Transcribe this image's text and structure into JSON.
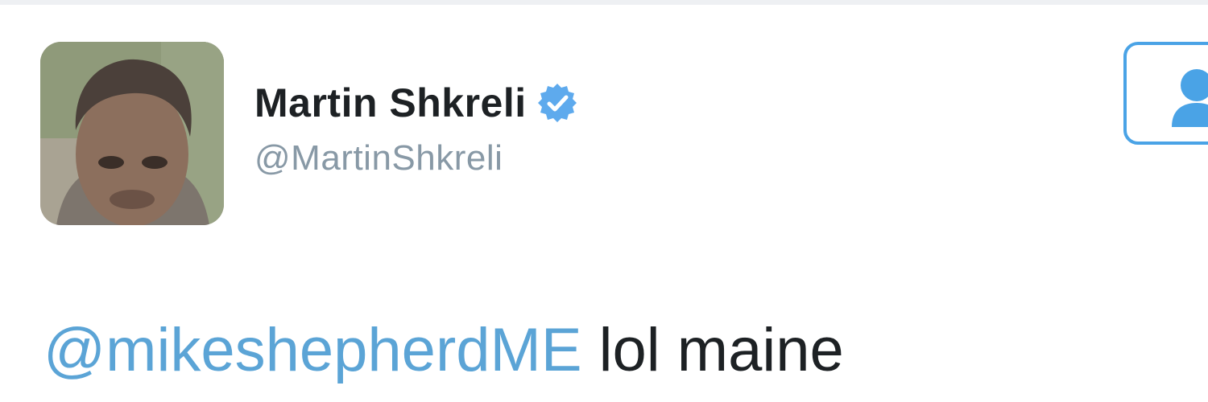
{
  "tweet": {
    "author": {
      "display_name": "Martin Shkreli",
      "handle": "@MartinShkreli",
      "verified": true,
      "avatar_icon": "avatar-photo"
    },
    "follow_button_icon": "follow-person-icon",
    "text": {
      "mention": "@mikeshepherdME",
      "body": " lol maine"
    }
  },
  "colors": {
    "name": "#1d2124",
    "handle": "#8899a6",
    "mention": "#5ba4d6",
    "verified_badge": "#5eaaed",
    "follow_button_border": "#4aa3e6"
  }
}
